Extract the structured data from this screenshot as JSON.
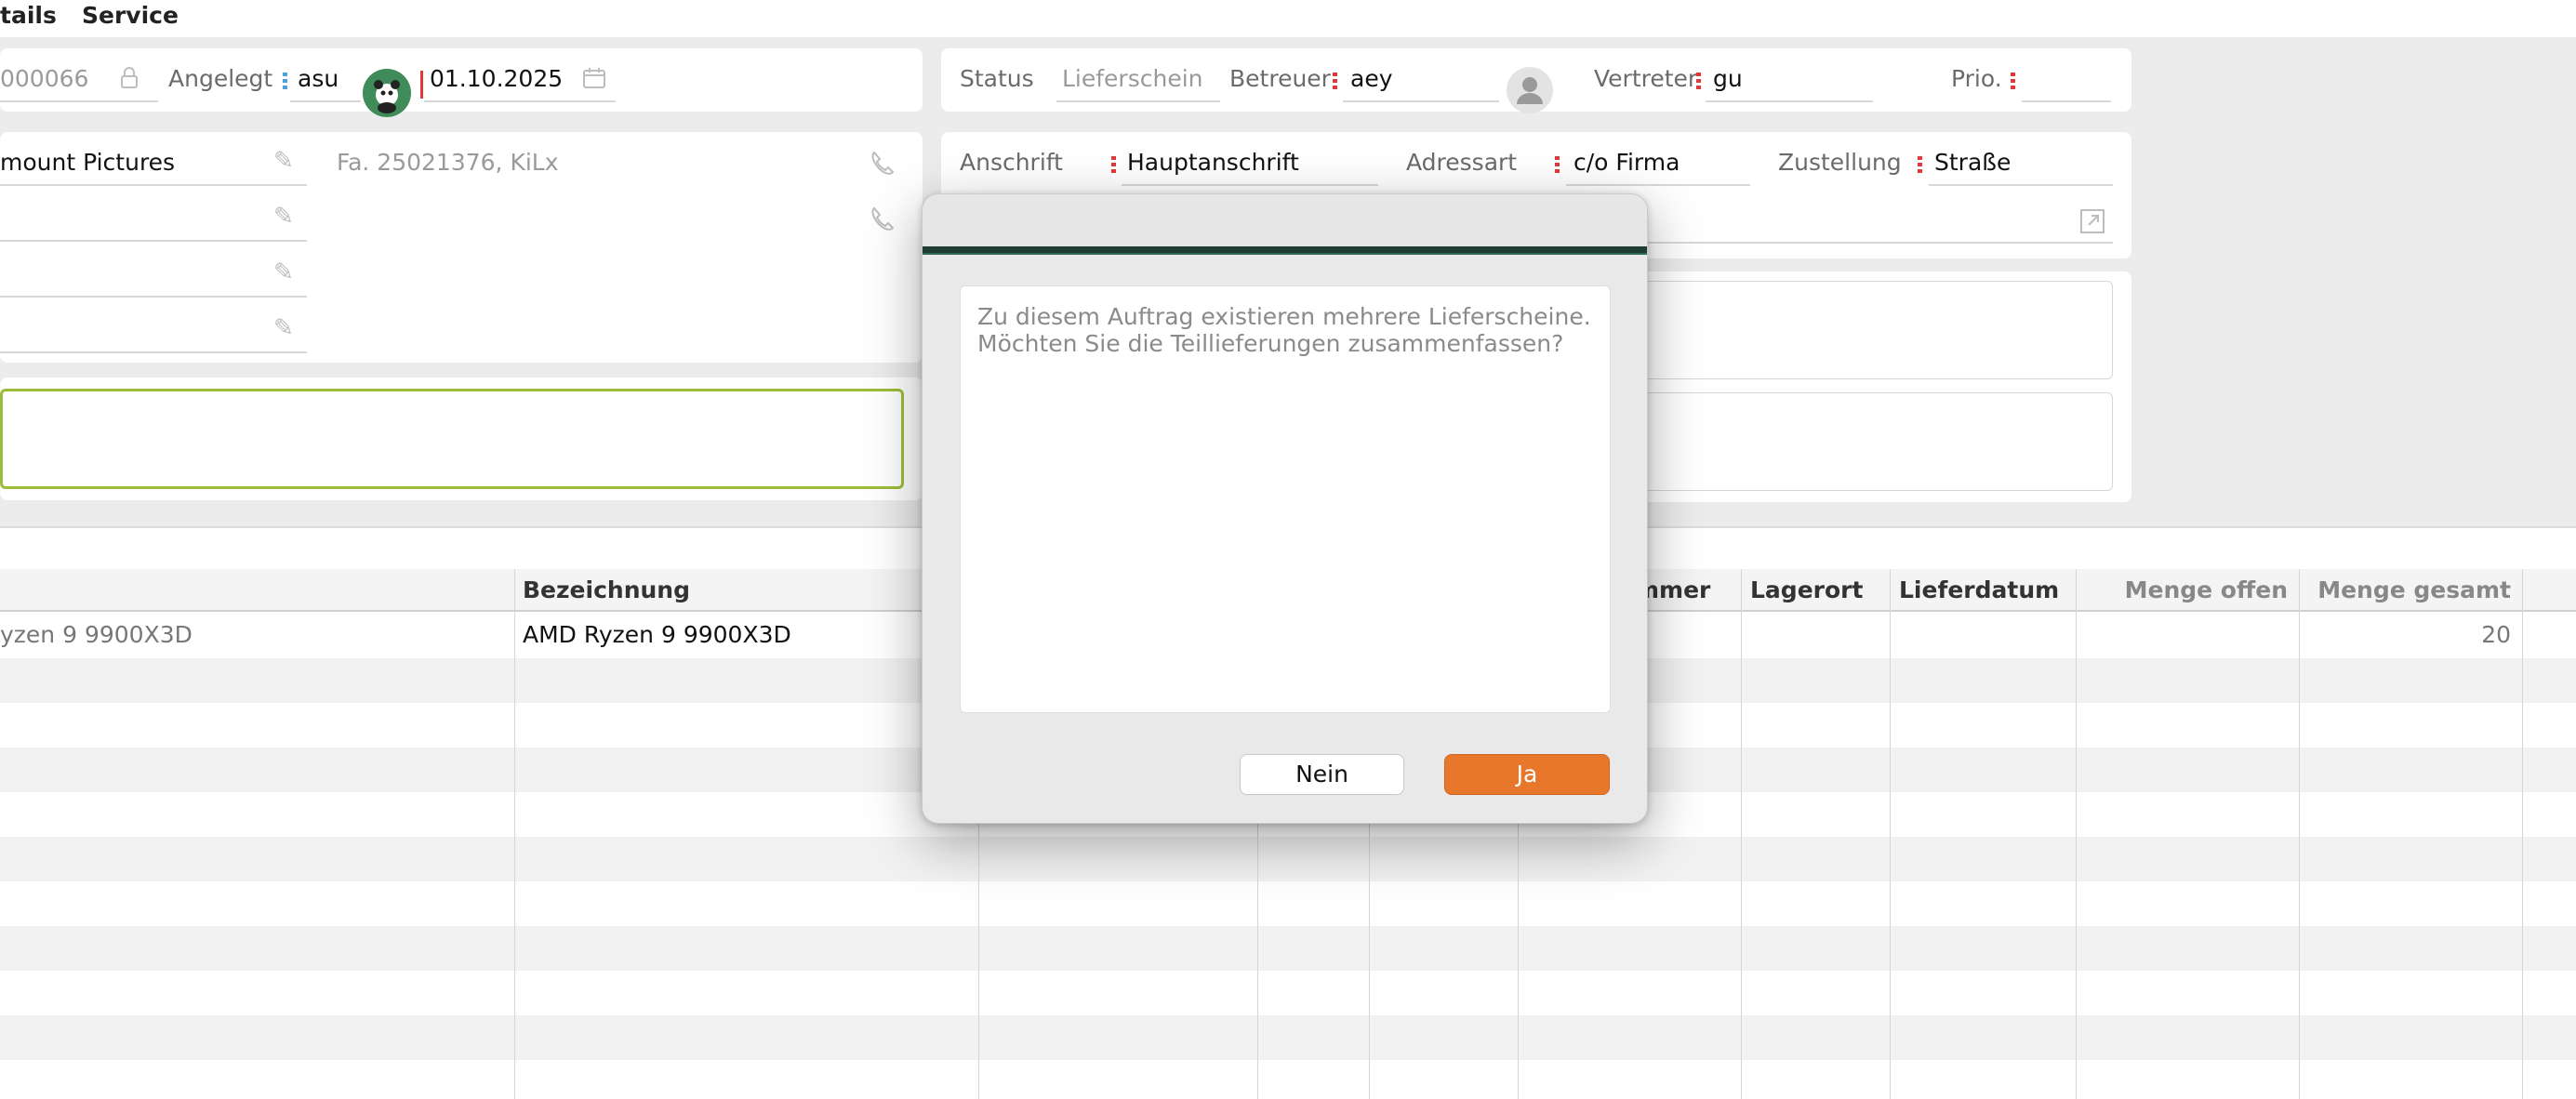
{
  "menu": {
    "items": [
      "tails",
      "Service"
    ]
  },
  "header": {
    "number_partial": "000066",
    "angelegt_label": "Angelegt",
    "angelegt_user": "asu",
    "date": "01.10.2025",
    "status_label": "Status",
    "status_value": "Lieferschein",
    "betreuer_label": "Betreuer",
    "betreuer_value": "aey",
    "vertreter_label": "Vertreter",
    "vertreter_value": "gu",
    "prio_label": "Prio."
  },
  "customer": {
    "name_partial": "mount Pictures",
    "info": "Fa. 25021376, KiLx"
  },
  "address": {
    "anschrift_label": "Anschrift",
    "anschrift_value": "Hauptanschrift",
    "adressart_label": "Adressart",
    "adressart_value": "c/o Firma",
    "zustellung_label": "Zustellung",
    "zustellung_value": "Straße"
  },
  "table": {
    "headers": {
      "bezeichnung": "Bezeichnung",
      "nummer_partial": "mmer",
      "lagerort": "Lagerort",
      "lieferdatum": "Lieferdatum",
      "menge_offen": "Menge offen",
      "menge_gesamt": "Menge gesamt"
    },
    "rows": [
      {
        "artikel_partial": "yzen 9 9900X3D",
        "bezeichnung": "AMD Ryzen 9 9900X3D",
        "menge_gesamt": "20"
      }
    ]
  },
  "dialog": {
    "message_line1": "Zu diesem Auftrag existieren mehrere Lieferscheine.",
    "message_line2": "Möchten Sie die Teillieferungen zusammenfassen?",
    "no_label": "Nein",
    "yes_label": "Ja"
  },
  "colors": {
    "accent_orange": "#e8762b",
    "dialog_bar": "#1f3d33",
    "required_marker": "#e2383a",
    "focus_border": "#9bbd3a"
  }
}
